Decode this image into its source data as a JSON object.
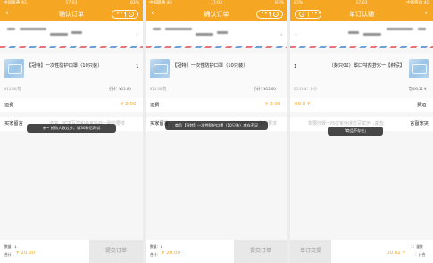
{
  "status_bar": {
    "carrier": "中国联通 4G",
    "time": "17:03",
    "battery": "83%",
    "mirrored_carrier": "中国移动 4G",
    "mirrored_time": "17:03"
  },
  "nav": {
    "title": "确认订单",
    "back_icon": "chevron-left-icon",
    "more_icon": "more-dots-icon",
    "close_icon": "record-circle-icon",
    "accent": "#f5a623"
  },
  "product": {
    "name": "【冠特】一次性防护口罩（10只装）",
    "quantity": "1",
    "unit_price": "¥12.00/包",
    "subtotal": "小计：¥12.00",
    "mirrored_quantity": "1",
    "mirrored_unit_price": "00.21 ¥：计小",
    "mirrored_subtotal": "包/00.21 ¥"
  },
  "freight": {
    "label": "运费",
    "value": "¥ 8.00",
    "mirrored_value": "00.8 ¥",
    "mirrored_label": "费运"
  },
  "message": {
    "label": "买家留言",
    "placeholder": "选填，可填写您和卖家协商一致的要求",
    "placeholder_short": "您和卖家协商一致的要求"
  },
  "toasts": [
    "亲~ 抢购人数过多，请30秒后再试",
    "商品【冠特】一次性防护口罩（10只装）库存不足",
    "「商品不存在」"
  ],
  "bottom": {
    "count": "数量：1",
    "total_label": "合计：",
    "total_value": "¥ 20.00",
    "submit_label": "提交订单",
    "mirrored_count": "1：量数",
    "mirrored_total_value": "00.02 ¥",
    "mirrored_total_label": "：计合",
    "mirrored_submit_label": "单订交提"
  },
  "mirrored_nav_title": "单订认确"
}
